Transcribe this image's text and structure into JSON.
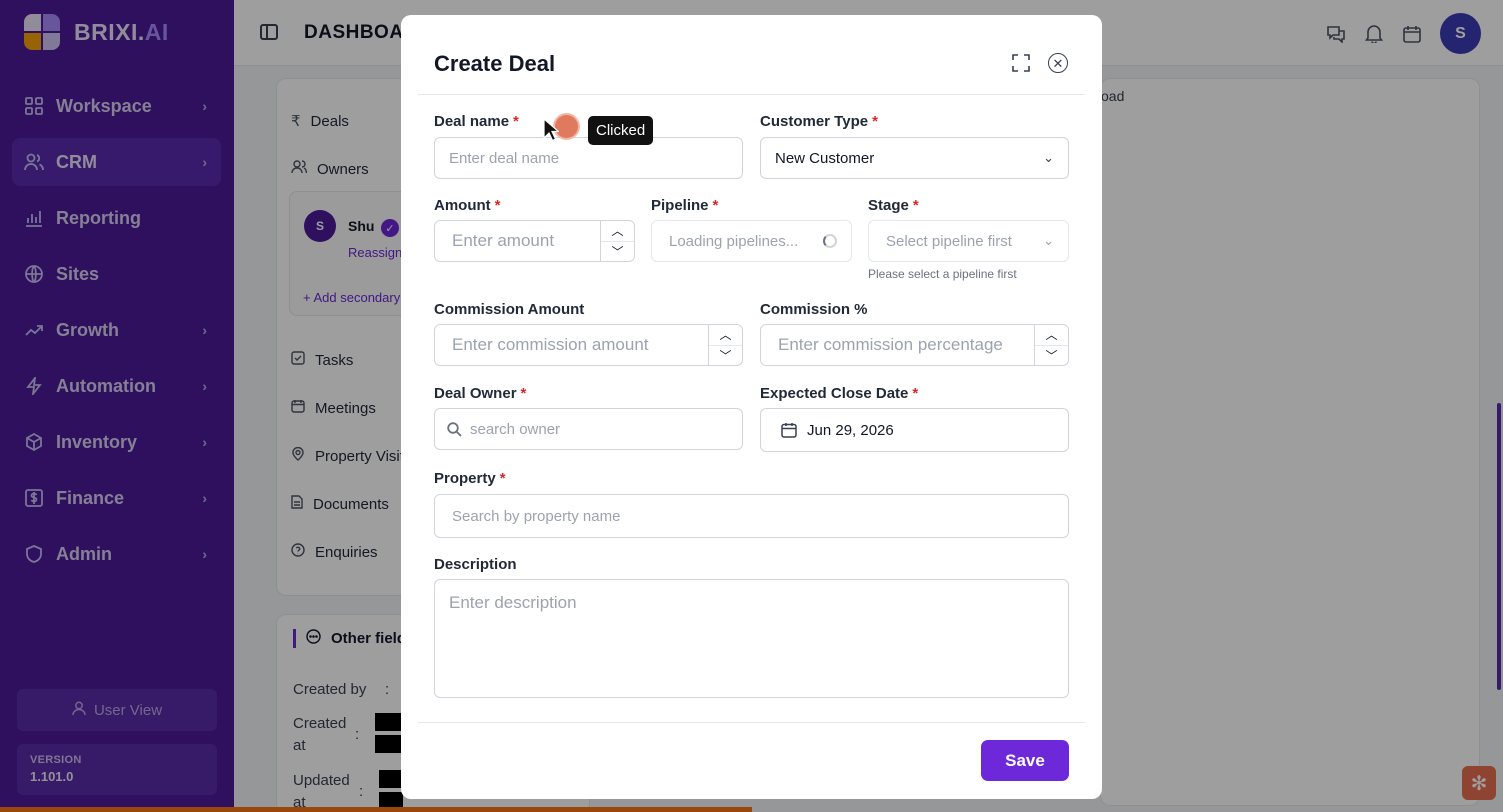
{
  "app": {
    "brand_main": "BRIXI.",
    "brand_accent": "AI",
    "header_title": "DASHBOARD"
  },
  "sidebar": {
    "items": [
      {
        "label": "Workspace",
        "icon": "grid-icon",
        "has_chevron": true
      },
      {
        "label": "CRM",
        "icon": "users-icon",
        "has_chevron": true,
        "active": true
      },
      {
        "label": "Reporting",
        "icon": "bar-chart-icon",
        "has_chevron": false
      },
      {
        "label": "Sites",
        "icon": "globe-icon",
        "has_chevron": false
      },
      {
        "label": "Growth",
        "icon": "trending-up-icon",
        "has_chevron": true
      },
      {
        "label": "Automation",
        "icon": "lightning-icon",
        "has_chevron": true
      },
      {
        "label": "Inventory",
        "icon": "box-icon",
        "has_chevron": true
      },
      {
        "label": "Finance",
        "icon": "dollar-icon",
        "has_chevron": true
      },
      {
        "label": "Admin",
        "icon": "shield-icon",
        "has_chevron": true
      }
    ],
    "user_view_label": "User View",
    "version_label": "VERSION",
    "version_value": "1.101.0"
  },
  "background": {
    "deals_label": "Deals",
    "owners_label": "Owners",
    "owner_initial": "S",
    "owner_name": "Shu",
    "reassign_label": "Reassign",
    "add_secondary_label": "+ Add secondary",
    "tasks_label": "Tasks",
    "meetings_label": "Meetings",
    "property_visits_label": "Property Visit",
    "documents_label": "Documents",
    "enquiries_label": "Enquiries",
    "other_fields_label": "Other field",
    "created_by_label": "Created by",
    "created_at_label_1": "Created",
    "created_at_label_2": "at",
    "updated_at_label_1": "Updated",
    "updated_at_label_2": "at",
    "colon": ":",
    "right_text": "oad",
    "avatar_initial": "S"
  },
  "modal": {
    "title": "Create Deal",
    "save_label": "Save",
    "fields": {
      "deal_name": {
        "label": "Deal name",
        "placeholder": "Enter deal name"
      },
      "customer_type": {
        "label": "Customer Type",
        "value": "New Customer"
      },
      "amount": {
        "label": "Amount",
        "placeholder": "Enter amount"
      },
      "pipeline": {
        "label": "Pipeline",
        "value": "Loading pipelines..."
      },
      "stage": {
        "label": "Stage",
        "value": "Select pipeline first",
        "help": "Please select a pipeline first"
      },
      "commission_amount": {
        "label": "Commission Amount",
        "placeholder": "Enter commission amount"
      },
      "commission_pct": {
        "label": "Commission %",
        "placeholder": "Enter commission percentage"
      },
      "deal_owner": {
        "label": "Deal Owner",
        "placeholder": "search owner"
      },
      "expected_close": {
        "label": "Expected Close Date",
        "value": "Jun 29, 2026"
      },
      "property": {
        "label": "Property",
        "placeholder": "Search by property name"
      },
      "description": {
        "label": "Description",
        "placeholder": "Enter description"
      }
    },
    "required_mark": "*"
  },
  "overlay_indicator": {
    "tooltip": "Clicked"
  },
  "colors": {
    "sidebar_bg": "#4b1a9a",
    "accent": "#6d28d9",
    "required": "#dc2626",
    "progress": "#f97316"
  }
}
